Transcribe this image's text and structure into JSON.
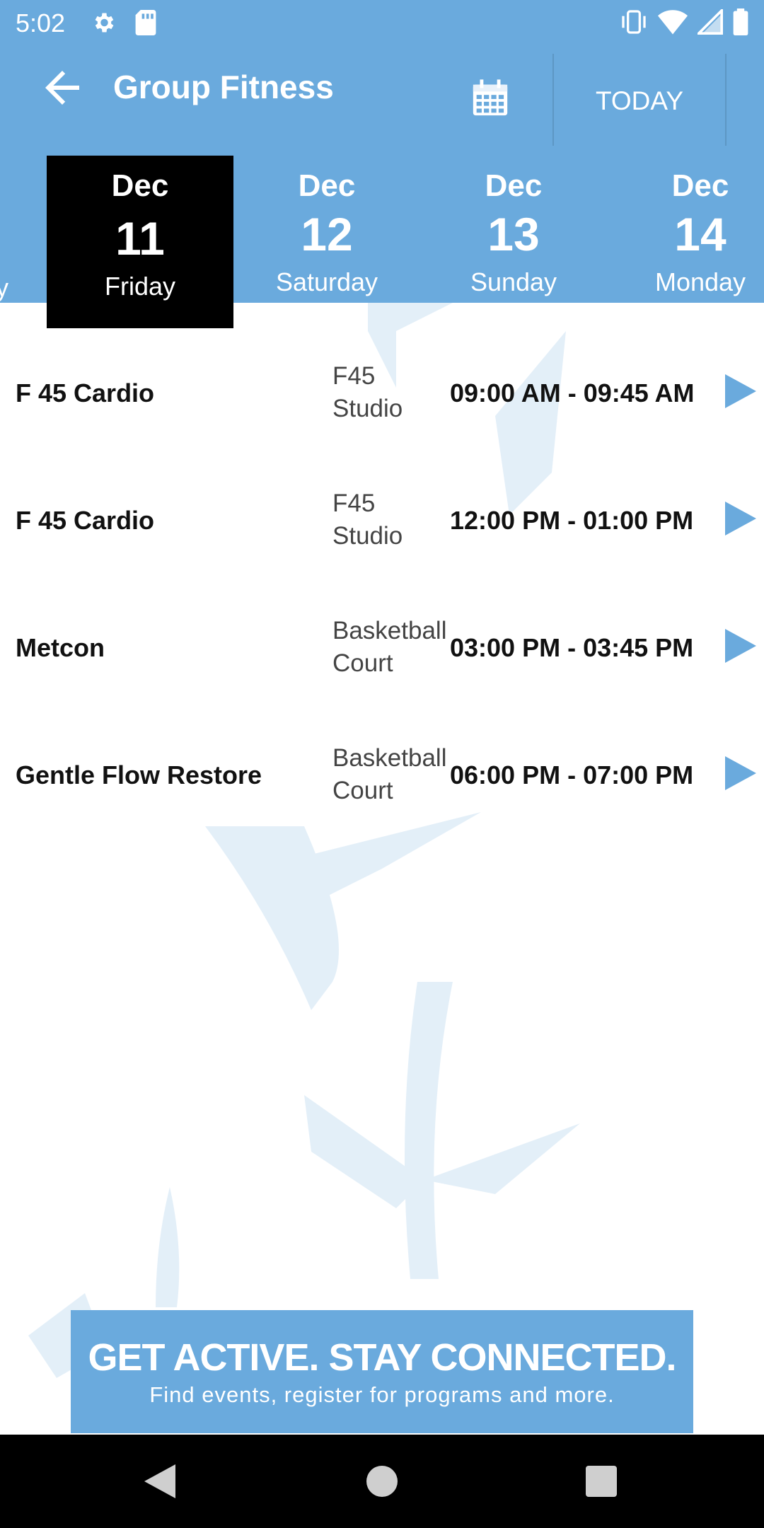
{
  "status_bar": {
    "time": "5:02",
    "left_icons": [
      "settings-icon",
      "sd-card-icon"
    ],
    "right_icons": [
      "vibrate-icon",
      "wifi-icon",
      "signal-icon",
      "battery-icon"
    ]
  },
  "toolbar": {
    "title": "Group Fitness",
    "today_label": "TODAY",
    "back_icon": "arrow-left-icon",
    "calendar_icon": "calendar-icon"
  },
  "date_strip": {
    "partial_prev": "y",
    "days": [
      {
        "month": "Dec",
        "day": "11",
        "weekday": "Friday",
        "selected": true
      },
      {
        "month": "Dec",
        "day": "12",
        "weekday": "Saturday",
        "selected": false
      },
      {
        "month": "Dec",
        "day": "13",
        "weekday": "Sunday",
        "selected": false
      },
      {
        "month": "Dec",
        "day": "14",
        "weekday": "Monday",
        "selected": false
      }
    ]
  },
  "classes": [
    {
      "name": "F 45 Cardio",
      "location": "F45 Studio",
      "time": "09:00 AM - 09:45 AM"
    },
    {
      "name": "F 45 Cardio",
      "location": "F45 Studio",
      "time": "12:00 PM - 01:00 PM"
    },
    {
      "name": "Metcon",
      "location": "Basketball Court",
      "time": "03:00 PM - 03:45 PM"
    },
    {
      "name": "Gentle Flow Restore",
      "location": "Basketball Court",
      "time": "06:00 PM - 07:00 PM"
    }
  ],
  "banner": {
    "headline": "GET ACTIVE.  STAY CONNECTED.",
    "subline": "Find events, register for programs and more."
  },
  "colors": {
    "primary": "#6aaadd",
    "selected_day_bg": "#000000",
    "arrow": "#6aaadd"
  }
}
